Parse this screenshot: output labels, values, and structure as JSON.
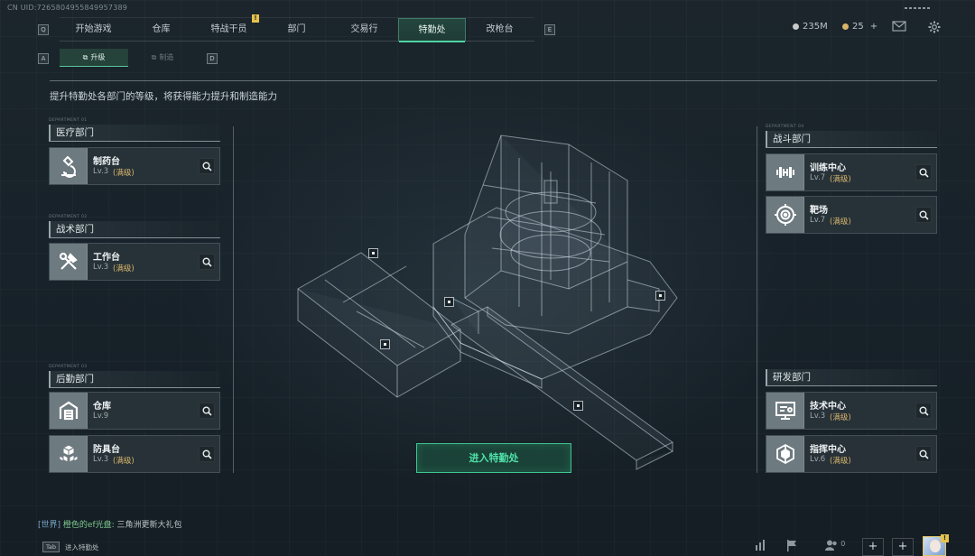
{
  "uid": "CN UID:7265804955849957389",
  "nav": {
    "key_left": "Q",
    "key_right": "E",
    "tabs": [
      {
        "label": "开始游戏"
      },
      {
        "label": "仓库"
      },
      {
        "label": "特战干员",
        "badge": "!"
      },
      {
        "label": "部门"
      },
      {
        "label": "交易行"
      },
      {
        "label": "特勤处",
        "active": true
      },
      {
        "label": "改枪台"
      }
    ]
  },
  "currency": {
    "silver": "235M",
    "gold": "25",
    "gold_add": "+"
  },
  "subtabs": {
    "key_left": "A",
    "key_right": "D",
    "items": [
      {
        "label": "升级",
        "active": true,
        "icon": "upgrade-icon"
      },
      {
        "label": "制造",
        "active": false,
        "icon": "craft-icon"
      }
    ]
  },
  "description": "提升特勤处各部门的等级，将获得能力提升和制造能力",
  "departments": {
    "medical": {
      "tag": "DEPARTMENT 01",
      "title": "医疗部门",
      "items": [
        {
          "name": "制药台",
          "level": "Lv.3",
          "status": "(满级)",
          "icon": "microscope-icon"
        }
      ]
    },
    "tactical": {
      "tag": "DEPARTMENT 02",
      "title": "战术部门",
      "items": [
        {
          "name": "工作台",
          "level": "Lv.3",
          "status": "(满级)",
          "icon": "tools-icon"
        }
      ]
    },
    "logistics": {
      "tag": "DEPARTMENT 03",
      "title": "后勤部门",
      "items": [
        {
          "name": "仓库",
          "level": "Lv.9",
          "status": "",
          "icon": "warehouse-icon"
        },
        {
          "name": "防具台",
          "level": "Lv.3",
          "status": "(满级)",
          "icon": "boxes-icon"
        }
      ]
    },
    "combat": {
      "tag": "DEPARTMENT 04",
      "title": "战斗部门",
      "items": [
        {
          "name": "训练中心",
          "level": "Lv.7",
          "status": "(满级)",
          "icon": "dumbbell-icon"
        },
        {
          "name": "靶场",
          "level": "Lv.7",
          "status": "(满级)",
          "icon": "target-icon"
        }
      ]
    },
    "research": {
      "title": "研发部门",
      "items": [
        {
          "name": "技术中心",
          "level": "Lv.3",
          "status": "(满级)",
          "icon": "monitor-icon"
        },
        {
          "name": "指挥中心",
          "level": "Lv.6",
          "status": "(满级)",
          "icon": "chip-icon"
        }
      ]
    }
  },
  "enter_button": "进入特勤处",
  "chat": {
    "channel": "[世界]",
    "user": "橙色的ef光盘:",
    "message": "三角洲更新大礼包"
  },
  "tab_hint": {
    "key": "Tab",
    "label": "进入特勤处"
  },
  "friends_count": "0",
  "avatar_badge": "!"
}
